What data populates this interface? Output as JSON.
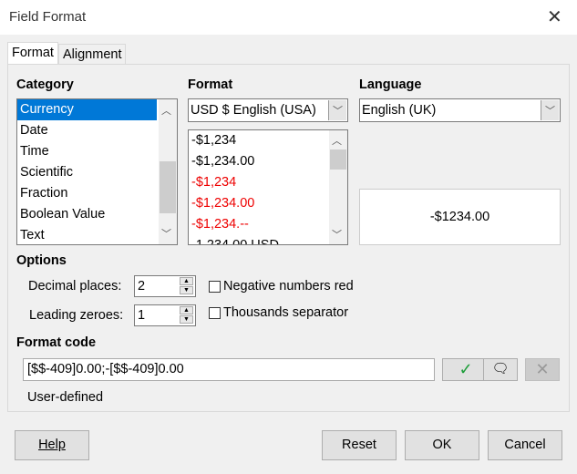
{
  "window": {
    "title": "Field Format",
    "close_icon": "close-icon"
  },
  "tabs": [
    {
      "label": "Format",
      "active": true
    },
    {
      "label": "Alignment",
      "active": false
    }
  ],
  "category": {
    "label": "Category",
    "items": [
      "Currency",
      "Date",
      "Time",
      "Scientific",
      "Fraction",
      "Boolean Value",
      "Text"
    ],
    "selected": "Currency"
  },
  "format": {
    "label": "Format",
    "currency": "USD  $  English (USA)",
    "items": [
      {
        "text": "-$1,234",
        "red": false
      },
      {
        "text": "-$1,234.00",
        "red": false
      },
      {
        "text": "-$1,234",
        "red": true
      },
      {
        "text": "-$1,234.00",
        "red": true
      },
      {
        "text": "-$1,234.--",
        "red": true
      },
      {
        "text": "-1,234.00 USD",
        "red": false
      }
    ]
  },
  "language": {
    "label": "Language",
    "value": "English (UK)"
  },
  "preview": "-$1234.00",
  "options": {
    "label": "Options",
    "decimal_label": "Decimal places:",
    "decimal_value": "2",
    "leading_label": "Leading zeroes:",
    "leading_value": "1",
    "negative_red_label": "Negative numbers red",
    "negative_red_checked": false,
    "thousands_label": "Thousands separator",
    "thousands_checked": false
  },
  "format_code": {
    "label": "Format code",
    "value": "[$$-409]0.00;-[$$-409]0.00",
    "status": "User-defined"
  },
  "buttons": {
    "help": "Help",
    "reset": "Reset",
    "ok": "OK",
    "cancel": "Cancel"
  },
  "colors": {
    "selection": "#0078d7",
    "negative": "#e00000",
    "check": "#1e9e3a"
  }
}
